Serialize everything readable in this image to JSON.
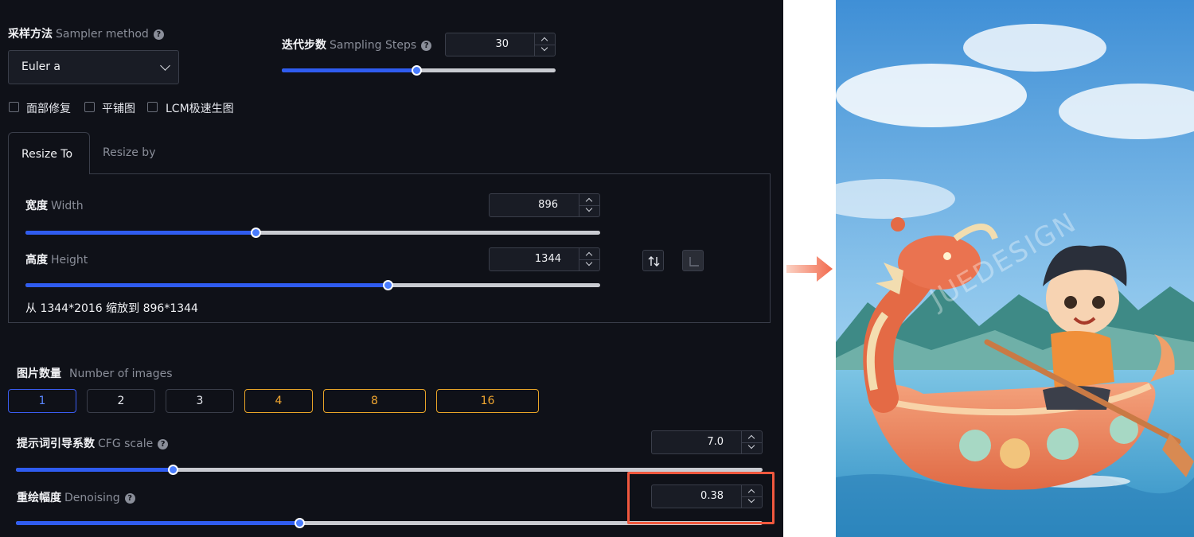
{
  "sampler": {
    "label_cn": "采样方法",
    "label_en": "Sampler method",
    "help": "?",
    "value": "Euler a"
  },
  "steps": {
    "label_cn": "迭代步数",
    "label_en": "Sampling Steps",
    "help": "?",
    "value": "30",
    "fraction": 0.49
  },
  "options": {
    "face_restore": "面部修复",
    "tiling": "平铺图",
    "lcm": "LCM极速生图"
  },
  "tabs": [
    {
      "label": "Resize To",
      "active": true
    },
    {
      "label": "Resize by",
      "active": false
    }
  ],
  "width": {
    "label_cn": "宽度",
    "label_en": "Width",
    "value": "896",
    "fraction": 0.4
  },
  "height": {
    "label_cn": "高度",
    "label_en": "Height",
    "value": "1344",
    "fraction": 0.63
  },
  "resize_note": "从 1344*2016 缩放到 896*1344",
  "images": {
    "label_cn": "图片数量",
    "label_en": "Number of images",
    "options": [
      "1",
      "2",
      "3",
      "4",
      "8",
      "16"
    ],
    "selected": "1"
  },
  "cfg": {
    "label_cn": "提示词引导系数",
    "label_en": "CFG scale",
    "help": "?",
    "value": "7.0",
    "fraction": 0.21
  },
  "denoising": {
    "label_cn": "重绘幅度",
    "label_en": "Denoising",
    "help": "?",
    "value": "0.38",
    "fraction": 0.38
  },
  "preview": {
    "watermark": "JUEDESIGN"
  },
  "colors": {
    "panel_bg": "#0f1118",
    "accent_blue": "#2f5cf0",
    "accent_orange": "#e8a428",
    "highlight_red": "#f0583e"
  }
}
